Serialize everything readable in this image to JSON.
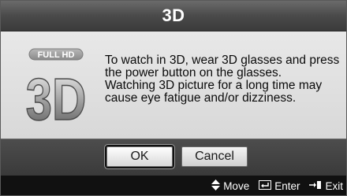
{
  "dialog": {
    "title": "3D",
    "logo": {
      "badge": "FULL HD",
      "mark": "3D",
      "icon": "full-hd-3d-logo"
    },
    "message": {
      "line1": "To watch in 3D, wear 3D glasses and press the power button on the glasses.",
      "line2": "Watching 3D picture for a long time may cause eye fatigue and/or dizziness."
    },
    "buttons": {
      "ok": "OK",
      "cancel": "Cancel"
    }
  },
  "help": {
    "move": {
      "icon": "up-down-arrows-icon",
      "label": "Move"
    },
    "enter": {
      "icon": "enter-icon",
      "label": "Enter"
    },
    "exit": {
      "icon": "exit-icon",
      "label": "Exit"
    }
  },
  "colors": {
    "title_bg": "#4a4a4a",
    "body_bg": "#d8d8d8",
    "help_bg": "#111111",
    "focus_ring": "#111111"
  }
}
